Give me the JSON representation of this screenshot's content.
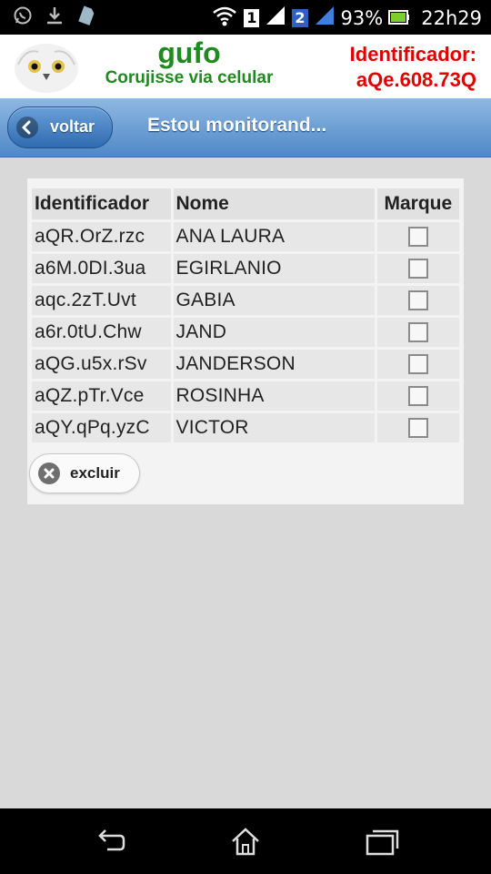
{
  "status_bar": {
    "battery_percent": "93%",
    "time": "22h29",
    "sim1_label": "1",
    "sim2_label": "2",
    "icons": [
      "whatsapp-icon",
      "download-icon",
      "sim-card-icon",
      "wifi-icon",
      "signal-icon",
      "battery-icon"
    ]
  },
  "header": {
    "brand_name": "gufo",
    "tagline": "Corujisse via celular",
    "identifier_label": "Identificador:",
    "identifier_value": "aQe.608.73Q",
    "colors": {
      "brand": "#1f8a1f",
      "identifier": "#e00000"
    }
  },
  "navbar": {
    "back_label": "voltar",
    "title": "Estou monitorand..."
  },
  "table": {
    "headers": {
      "id": "Identificador",
      "name": "Nome",
      "mark": "Marque"
    },
    "rows": [
      {
        "id": "aQR.OrZ.rzc",
        "name": "ANA LAURA",
        "checked": false
      },
      {
        "id": "a6M.0DI.3ua",
        "name": "EGIRLANIO",
        "checked": false
      },
      {
        "id": "aqc.2zT.Uvt",
        "name": "GABIA",
        "checked": false
      },
      {
        "id": "a6r.0tU.Chw",
        "name": "JAND",
        "checked": false
      },
      {
        "id": "aQG.u5x.rSv",
        "name": "JANDERSON",
        "checked": false
      },
      {
        "id": "aQZ.pTr.Vce",
        "name": "ROSINHA",
        "checked": false
      },
      {
        "id": "aQY.qPq.yzC",
        "name": "VICTOR",
        "checked": false
      }
    ]
  },
  "actions": {
    "delete_label": "excluir"
  },
  "system_nav": {
    "icons": [
      "back-icon",
      "home-icon",
      "recents-icon"
    ]
  }
}
